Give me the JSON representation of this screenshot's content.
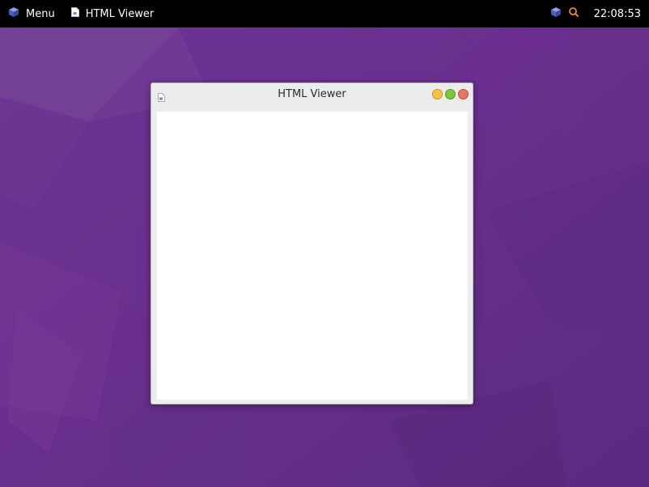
{
  "panel": {
    "menu_label": "Menu",
    "menu_icon": "cube-icon",
    "taskbar_items": [
      {
        "label": "HTML Viewer",
        "icon": "document-icon"
      }
    ],
    "tray_icons": [
      "cube-icon",
      "magnifier-icon"
    ],
    "clock": "22:08:53"
  },
  "window": {
    "title": "HTML Viewer",
    "icon": "document-icon",
    "controls": [
      "minimize",
      "maximize",
      "close"
    ]
  },
  "colors": {
    "panel_bg": "#000000",
    "desktop_bg": "#5f2c86",
    "minimize": "#f5c242",
    "maximize": "#7dc43f",
    "close": "#ea7563"
  }
}
